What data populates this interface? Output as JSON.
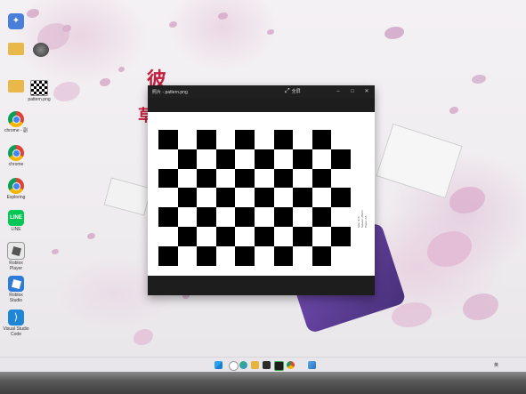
{
  "wallpaper": {
    "text_chars": [
      "彼",
      "草"
    ]
  },
  "desktop_icons": [
    {
      "label": "",
      "icon": "app-icon",
      "color": "#4a7fd9"
    },
    {
      "label": "",
      "icon": "folder-icon",
      "color": "#e8b84a"
    },
    {
      "label": "",
      "icon": "folder-icon",
      "color": "#e8b84a"
    },
    {
      "label": "chrome - 副",
      "icon": "chrome-icon",
      "color": "#d93025"
    },
    {
      "label": "chrome",
      "icon": "chrome-icon",
      "color": "#d93025"
    },
    {
      "label": "Exploring",
      "icon": "chrome-icon",
      "color": "#d93025"
    },
    {
      "label": "LINE",
      "icon": "line-icon",
      "color": "#06c755"
    },
    {
      "label": "Roblox Player",
      "icon": "roblox-icon",
      "color": "#7d7d7d"
    },
    {
      "label": "Roblox Studio",
      "icon": "roblox-studio-icon",
      "color": "#2f7bd8"
    },
    {
      "label": "Visual Studio Code",
      "icon": "vscode-icon",
      "color": "#1f86d6"
    }
  ],
  "desktop_icons_col2": [
    {
      "label": "",
      "icon": "3d-icon"
    },
    {
      "label": "pattern.png",
      "icon": "checkerboard-icon"
    }
  ],
  "window": {
    "title": "照片 - pattern.png",
    "fullscreen_label": "全屏",
    "fine_print": [
      "Size: 9×6",
      "Square: 25mm",
      "Paper: A4"
    ]
  },
  "taskbar": {
    "apps": [
      "start-icon",
      "search-icon",
      "copilot-icon",
      "folder-icon",
      "terminal-icon",
      "chrome-icon",
      "photos-icon"
    ],
    "tray_lang": "英"
  },
  "colors": {
    "accent_red": "#c2203f",
    "window_bg": "#1d1d1d",
    "taskbar_bg": "#e8e6ea"
  }
}
